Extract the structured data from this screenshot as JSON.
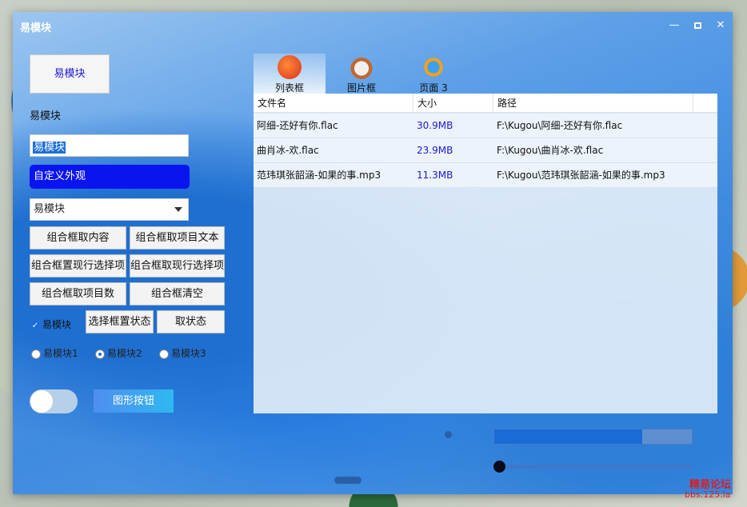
{
  "window": {
    "title": "易模块"
  },
  "left": {
    "big_button": "易模块",
    "label": "易模块",
    "edit_value": "易模块",
    "custom_button": "自定义外观",
    "combo_value": "易模块",
    "buttons": [
      "组合框取内容",
      "组合框取项目文本",
      "组合框置现行选择项",
      "组合框取现行选择项",
      "组合框取项目数",
      "组合框清空",
      "选择框置状态",
      "取状态"
    ],
    "checkbox_label": "易模块",
    "checkbox_checked": true,
    "radios": [
      "易模块1",
      "易模块2",
      "易模块3"
    ],
    "radio_selected": "易模块2",
    "toggle_on": false,
    "graphic_button": "图形按钮"
  },
  "tabs": [
    {
      "label": "列表框",
      "icon": "red-ghost-icon",
      "active": true
    },
    {
      "label": "图片框",
      "icon": "rabbit-icon",
      "active": false
    },
    {
      "label": "页面 3",
      "icon": "planet-icon",
      "active": false
    }
  ],
  "listview": {
    "columns": [
      "文件名",
      "大小",
      "路径"
    ],
    "rows": [
      {
        "name": "阿细-还好有你.flac",
        "size": "30.9MB",
        "path": "F:\\Kugou\\阿细-还好有你.flac"
      },
      {
        "name": "曲肖冰-欢.flac",
        "size": "23.9MB",
        "path": "F:\\Kugou\\曲肖冰-欢.flac"
      },
      {
        "name": "范玮琪张韶涵-如果的事.mp3",
        "size": "11.3MB",
        "path": "F:\\Kugou\\范玮琪张韶涵-如果的事.mp3"
      }
    ]
  },
  "progress": {
    "fraction": 0.75
  },
  "slider": {
    "fraction": 0.0
  },
  "watermark": {
    "line1": "精易论坛",
    "line2": "bbs.125.la"
  },
  "colors": {
    "accent": "#1a6fd8",
    "custom_button": "#0a14f0",
    "link_text": "#1a1ad0"
  }
}
